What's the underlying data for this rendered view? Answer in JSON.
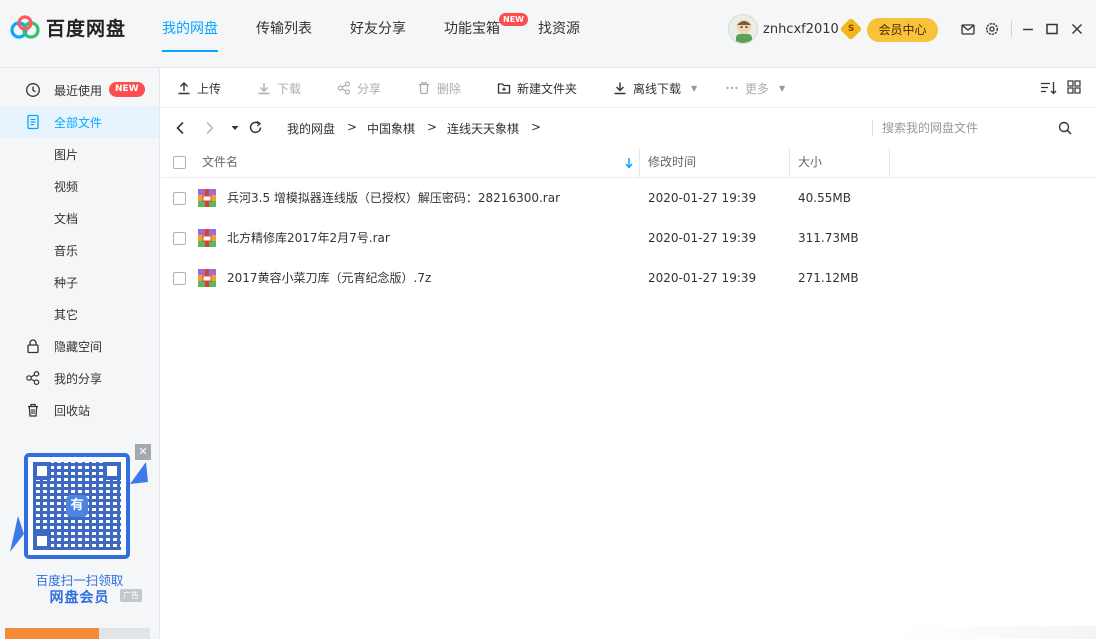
{
  "app": {
    "name": "百度网盘",
    "brand_color": "#06a7ff"
  },
  "nav": {
    "items": [
      {
        "label": "我的网盘",
        "active": true
      },
      {
        "label": "传输列表",
        "active": false
      },
      {
        "label": "好友分享",
        "active": false
      },
      {
        "label": "功能宝箱",
        "active": false,
        "badge": "NEW"
      },
      {
        "label": "找资源",
        "active": false
      }
    ]
  },
  "user": {
    "name": "znhcxf2010",
    "vip_badge": "S",
    "vip_button": "会员中心"
  },
  "window_icons": [
    "mail-icon",
    "settings-icon",
    "minimize-icon",
    "maximize-icon",
    "close-icon"
  ],
  "sidebar": {
    "items": [
      {
        "label": "最近使用",
        "icon": "clock-icon",
        "badge": "NEW"
      },
      {
        "label": "全部文件",
        "icon": "file-icon",
        "active": true
      },
      {
        "label": "图片"
      },
      {
        "label": "视频"
      },
      {
        "label": "文档"
      },
      {
        "label": "音乐"
      },
      {
        "label": "种子"
      },
      {
        "label": "其它"
      },
      {
        "label": "隐藏空间",
        "icon": "lock-icon"
      },
      {
        "label": "我的分享",
        "icon": "share-icon"
      },
      {
        "label": "回收站",
        "icon": "trash-icon"
      }
    ],
    "ad": {
      "line1": "百度扫一扫领取",
      "line2": "网盘会员",
      "tag": "广告",
      "qr_center": "有"
    },
    "storage_used_fraction": 0.65
  },
  "toolbar": {
    "upload": "上传",
    "download": "下载",
    "share": "分享",
    "delete": "删除",
    "new_folder": "新建文件夹",
    "offline_download": "离线下载",
    "more": "更多"
  },
  "address": {
    "breadcrumbs": [
      "我的网盘",
      "中国象棋",
      "连线天天象棋"
    ],
    "search_placeholder": "搜索我的网盘文件"
  },
  "table": {
    "headers": {
      "name": "文件名",
      "modified": "修改时间",
      "size": "大小"
    },
    "rows": [
      {
        "name": "兵河3.5 增模拟器连线版（已授权）解压密码：28216300.rar",
        "modified": "2020-01-27 19:39",
        "size": "40.55MB"
      },
      {
        "name": "北方精修库2017年2月7号.rar",
        "modified": "2020-01-27 19:39",
        "size": "311.73MB"
      },
      {
        "name": "2017黄容小菜刀库（元宵纪念版）.7z",
        "modified": "2020-01-27 19:39",
        "size": "271.12MB"
      }
    ]
  }
}
